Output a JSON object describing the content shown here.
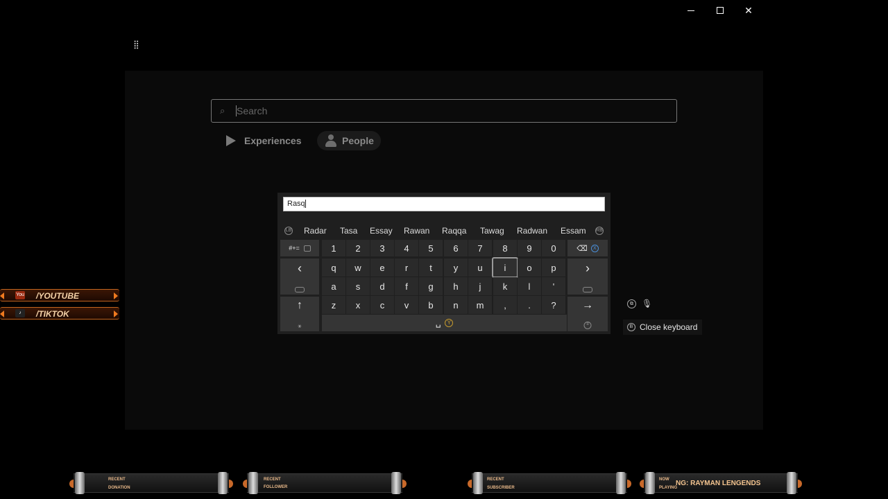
{
  "window": {
    "controls": {
      "minimize": "minimize",
      "maximize": "maximize",
      "close": "✕"
    },
    "menu_icon": "⣿"
  },
  "search": {
    "placeholder": "Search",
    "icon": "⌕"
  },
  "tabs": [
    {
      "label": "Experiences",
      "icon": "play-icon",
      "selected": false
    },
    {
      "label": "People",
      "icon": "person-icon",
      "selected": true
    }
  ],
  "keyboard": {
    "text_value": "Rasq",
    "suggestions": [
      "Radar",
      "Tasa",
      "Essay",
      "Rawan",
      "Raqqa",
      "Tawag",
      "Radwan",
      "Essam"
    ],
    "suggestion_nav_left": "LB",
    "suggestion_nav_right": "RB",
    "symbols_key": "#+=",
    "number_row": [
      "1",
      "2",
      "3",
      "4",
      "5",
      "6",
      "7",
      "8",
      "9",
      "0"
    ],
    "row_q": [
      "q",
      "w",
      "e",
      "r",
      "t",
      "y",
      "u",
      "i",
      "o",
      "p"
    ],
    "row_a": [
      "a",
      "s",
      "d",
      "f",
      "g",
      "h",
      "j",
      "k",
      "l",
      "'"
    ],
    "row_z": [
      "z",
      "x",
      "c",
      "v",
      "b",
      "n",
      "m",
      ",",
      ".",
      "?"
    ],
    "selected_key": "i",
    "backspace_hint": "X",
    "space_hint": "Y",
    "close_keyboard": "Close keyboard",
    "close_hint": "B"
  },
  "overlay": {
    "socials": [
      {
        "label": "/YOUTUBE",
        "logo": "You"
      },
      {
        "label": "/TIKTOK",
        "logo": "♪"
      }
    ],
    "bars": [
      {
        "line1": "RECENT",
        "line2": "DONATION",
        "value": ""
      },
      {
        "line1": "RECENT",
        "line2": "FOLLOWER",
        "value": ""
      },
      {
        "line1": "RECENT",
        "line2": "SUBSCRIBER",
        "value": ""
      },
      {
        "line1": "NOW",
        "line2": "PLAYING",
        "value": "NG: RAYMAN LENGENDS"
      }
    ]
  }
}
